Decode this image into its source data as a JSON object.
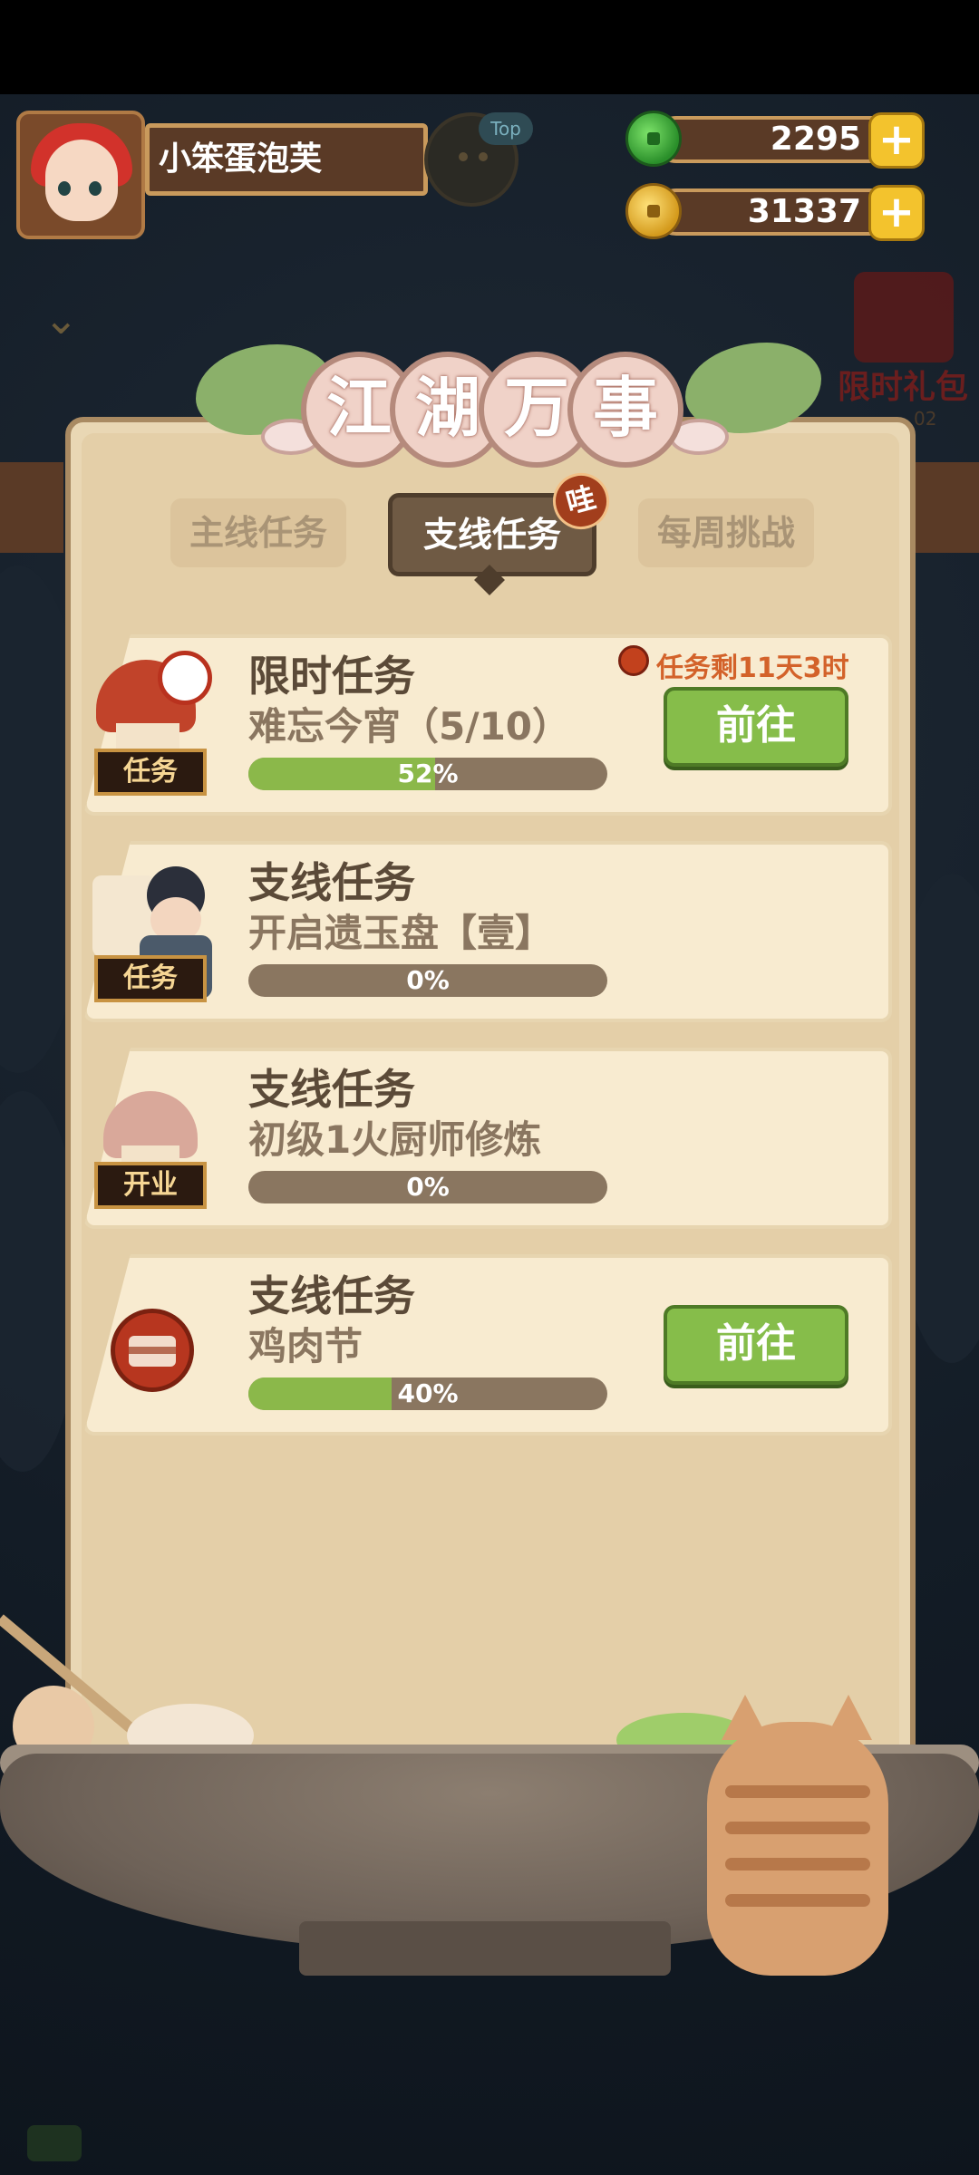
{
  "player": {
    "name": "小笨蛋泡芙",
    "top_badge": "Top"
  },
  "currencies": [
    {
      "name": "jade",
      "value": "2295",
      "icon": "jade-coin-icon",
      "color": "#4caf3a"
    },
    {
      "name": "gold",
      "value": "31337",
      "icon": "gold-coin-icon",
      "color": "#e8b33a"
    }
  ],
  "gift": {
    "label": "限时礼包",
    "timer": "02"
  },
  "title": {
    "chars": [
      "江",
      "湖",
      "万",
      "事"
    ]
  },
  "tabs": [
    {
      "label": "主线任务",
      "active": false
    },
    {
      "label": "支线任务",
      "active": true
    },
    {
      "label": "每周挑战",
      "active": false
    }
  ],
  "badge": "哇",
  "tasks": [
    {
      "title": "限时任务",
      "subtitle": "难忘今宵（5/10）",
      "progress": 0.52,
      "progress_text": "52%",
      "button": "前往",
      "timer": "任务剩11天3时",
      "tag": "任务",
      "icon": "mushroom-clock-icon"
    },
    {
      "title": "支线任务",
      "subtitle": "开启遗玉盘【壹】",
      "progress": 0.0,
      "progress_text": "0%",
      "button": "",
      "tag": "任务",
      "icon": "scholar-character-icon"
    },
    {
      "title": "支线任务",
      "subtitle": "初级1火厨师修炼",
      "progress": 0.0,
      "progress_text": "0%",
      "button": "",
      "tag": "开业",
      "icon": "mushroom-shop-icon"
    },
    {
      "title": "支线任务",
      "subtitle": "鸡肉节",
      "progress": 0.4,
      "progress_text": "40%",
      "button": "前往",
      "tag": "",
      "icon": "meat-plate-icon"
    }
  ],
  "colors": {
    "accent_green": "#86bd4a",
    "panel": "#e9d7b4",
    "timer_text": "#d3622a"
  }
}
